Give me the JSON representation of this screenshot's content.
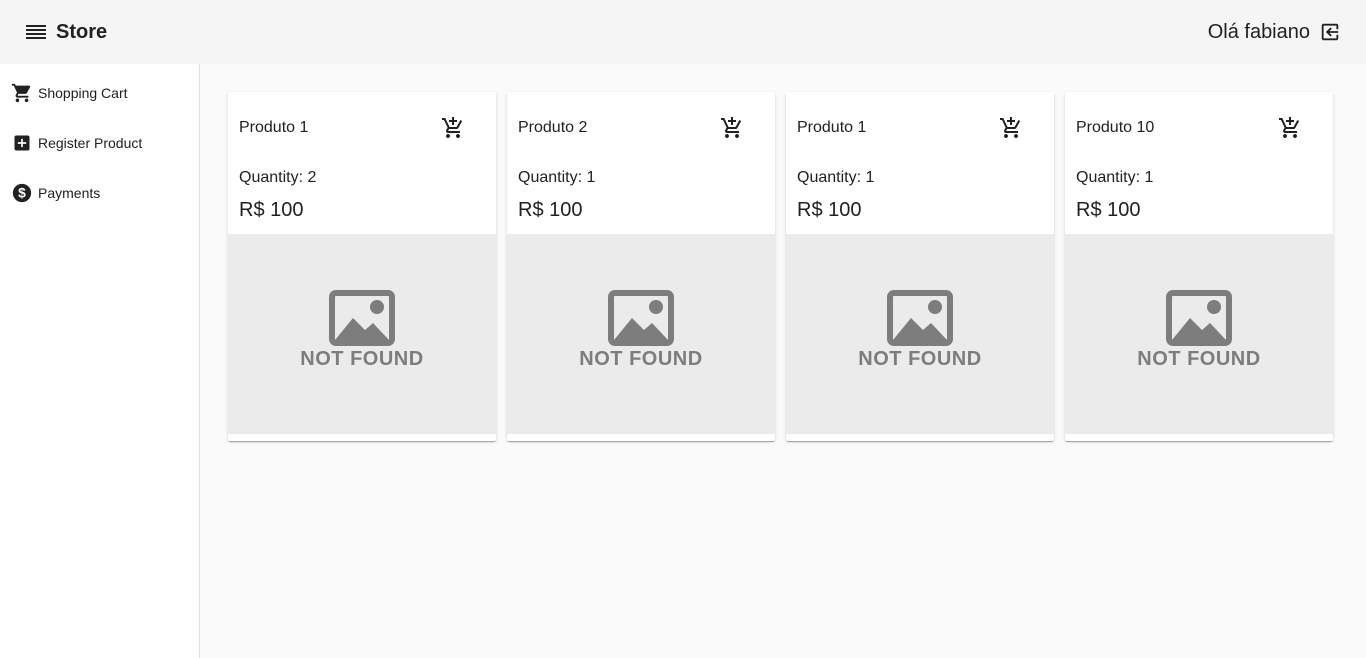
{
  "header": {
    "title": "Store",
    "greeting": "Olá fabiano",
    "menu_icon": "menu-icon",
    "logout_icon": "logout-icon"
  },
  "sidebar": {
    "items": [
      {
        "label": "Shopping Cart",
        "icon": "shopping-cart-icon"
      },
      {
        "label": "Register Product",
        "icon": "add-box-icon"
      },
      {
        "label": "Payments",
        "icon": "dollar-icon"
      }
    ]
  },
  "products": [
    {
      "name": "Produto 1",
      "quantity": "Quantity: 2",
      "price": "R$ 100",
      "image_text": "NOT FOUND"
    },
    {
      "name": "Produto 2",
      "quantity": "Quantity: 1",
      "price": "R$ 100",
      "image_text": "NOT FOUND"
    },
    {
      "name": "Produto 1",
      "quantity": "Quantity: 1",
      "price": "R$ 100",
      "image_text": "NOT FOUND"
    },
    {
      "name": "Produto 10",
      "quantity": "Quantity: 1",
      "price": "R$ 100",
      "image_text": "NOT FOUND"
    }
  ],
  "colors": {
    "toolbar_bg": "#f5f5f5",
    "content_bg": "#fafafa",
    "image_placeholder_bg": "#ebebeb",
    "not_found_text": "#7d7d7d"
  }
}
